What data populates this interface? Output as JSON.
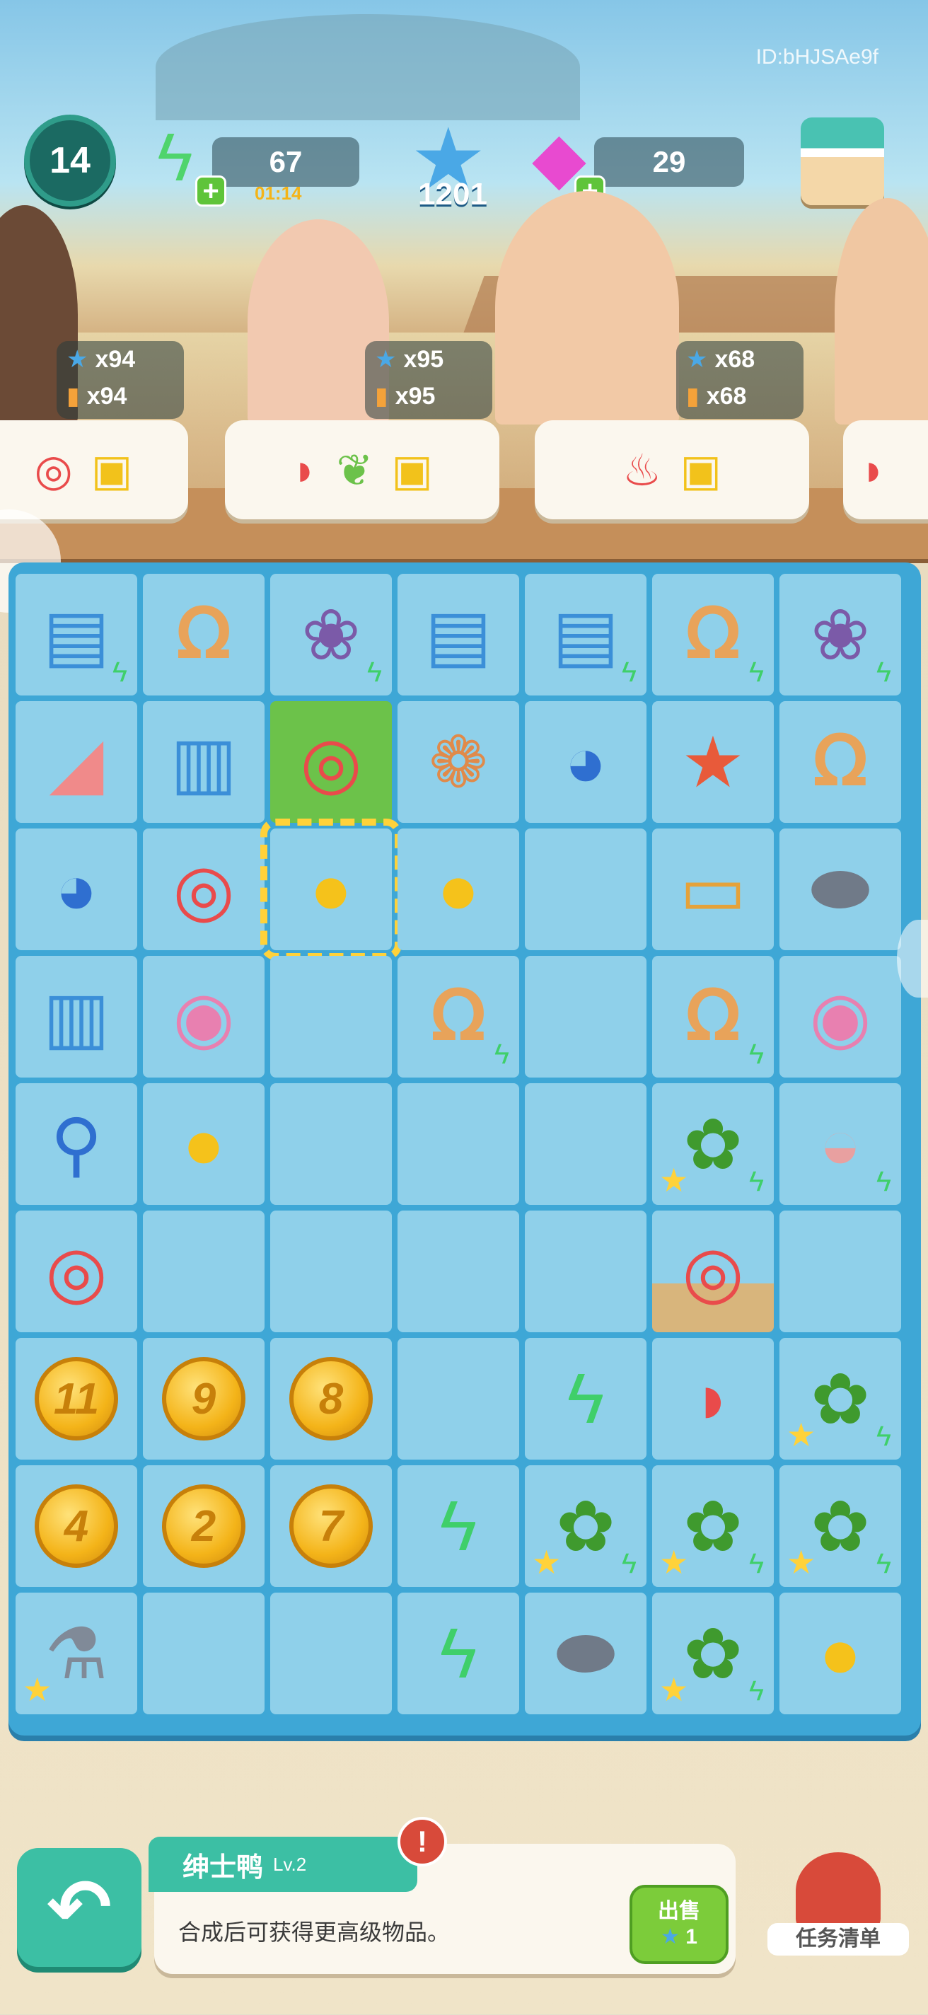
{
  "hud": {
    "id_text": "ID:bHJSAe9f",
    "level": "14",
    "energy": "67",
    "energy_timer": "01:14",
    "stars": "1201",
    "gems": "29"
  },
  "characters": [
    {
      "top_count": "x94",
      "bottom_count": "x94"
    },
    {
      "top_count": "x95",
      "bottom_count": "x95"
    },
    {
      "top_count": "x68",
      "bottom_count": "x68"
    }
  ],
  "orders": [
    {
      "icons": [
        "ring",
        "truck"
      ]
    },
    {
      "icons": [
        "watermelon",
        "parrot",
        "truck"
      ]
    },
    {
      "icons": [
        "drink",
        "truck"
      ]
    },
    {
      "icons": [
        "watermelon"
      ]
    }
  ],
  "board": [
    [
      "cart",
      "shell",
      "coral",
      "cart",
      "cart",
      "shell",
      "coral"
    ],
    [
      "seashell",
      "bucket",
      "ring",
      "conch",
      "whale",
      "starfish",
      "shell"
    ],
    [
      "whale",
      "ring",
      "duck",
      "duck",
      "",
      "box",
      "rock"
    ],
    [
      "bucket",
      "donut",
      "",
      "shell",
      "",
      "shell",
      "donut"
    ],
    [
      "shovel",
      "duck",
      "",
      "",
      "",
      "cabbage",
      "clam"
    ],
    [
      "ring",
      "",
      "",
      "",
      "",
      "ring",
      ""
    ],
    [
      "11",
      "9",
      "8",
      "",
      "bolt",
      "watermelon",
      "cabbage"
    ],
    [
      "4",
      "2",
      "7",
      "bolt",
      "cabbage",
      "cabbage",
      "cabbage"
    ],
    [
      "juicer",
      "",
      "",
      "bolt",
      "rock",
      "cabbage",
      "duck"
    ]
  ],
  "item_info": {
    "name": "绅士鸭",
    "level": "Lv.2",
    "description": "合成后可获得更高级物品。",
    "sell_label": "出售",
    "sell_price": "1",
    "alert": "!"
  },
  "task_list_label": "任务清单"
}
